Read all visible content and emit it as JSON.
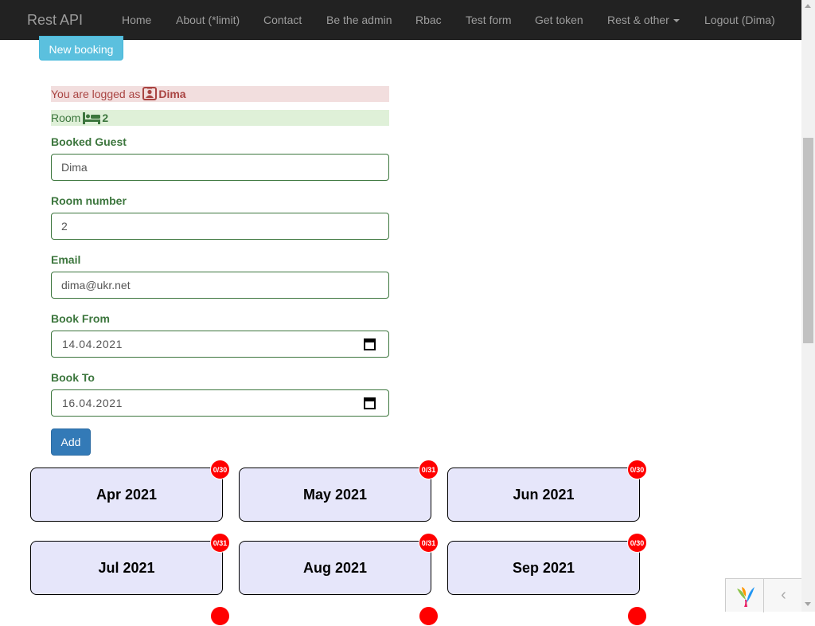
{
  "navbar": {
    "brand": "Rest API",
    "items": [
      {
        "label": "Home"
      },
      {
        "label": "About (*limit)"
      },
      {
        "label": "Contact"
      },
      {
        "label": "Be the admin"
      },
      {
        "label": "Rbac"
      },
      {
        "label": "Test form"
      },
      {
        "label": "Get token"
      },
      {
        "label": "Rest & other",
        "dropdown": true
      },
      {
        "label": "Logout (Dima)"
      }
    ]
  },
  "new_booking_label": "New booking",
  "alerts": {
    "logged_prefix": "You are logged as",
    "logged_user": "Dima",
    "room_prefix": "Room",
    "room_value": "2"
  },
  "form": {
    "guest": {
      "label": "Booked Guest",
      "value": "Dima"
    },
    "room": {
      "label": "Room number",
      "value": "2"
    },
    "email": {
      "label": "Email",
      "value": "dima@ukr.net"
    },
    "from": {
      "label": "Book From",
      "value": "14.04.2021"
    },
    "to": {
      "label": "Book To",
      "value": "16.04.2021"
    },
    "submit_label": "Add"
  },
  "months": [
    {
      "label": "Apr 2021",
      "badge": "0/30"
    },
    {
      "label": "May 2021",
      "badge": "0/31"
    },
    {
      "label": "Jun 2021",
      "badge": "0/30"
    },
    {
      "label": "Jul 2021",
      "badge": "0/31"
    },
    {
      "label": "Aug 2021",
      "badge": "0/31"
    },
    {
      "label": "Sep 2021",
      "badge": "0/30"
    }
  ],
  "colors": {
    "navbar_bg": "#222222",
    "info_button": "#5bc0de",
    "primary_button": "#337ab7",
    "success_text": "#3c763d",
    "danger_text": "#a94442",
    "month_card_bg": "#e6e6fa",
    "badge_bg": "#ff0000"
  },
  "icons": {
    "user_icon": "user-icon",
    "bed_icon": "bed-icon",
    "calendar_icon": "calendar-icon",
    "yii_logo": "yii-logo",
    "toolbar_toggle": "chevron-left-icon"
  }
}
